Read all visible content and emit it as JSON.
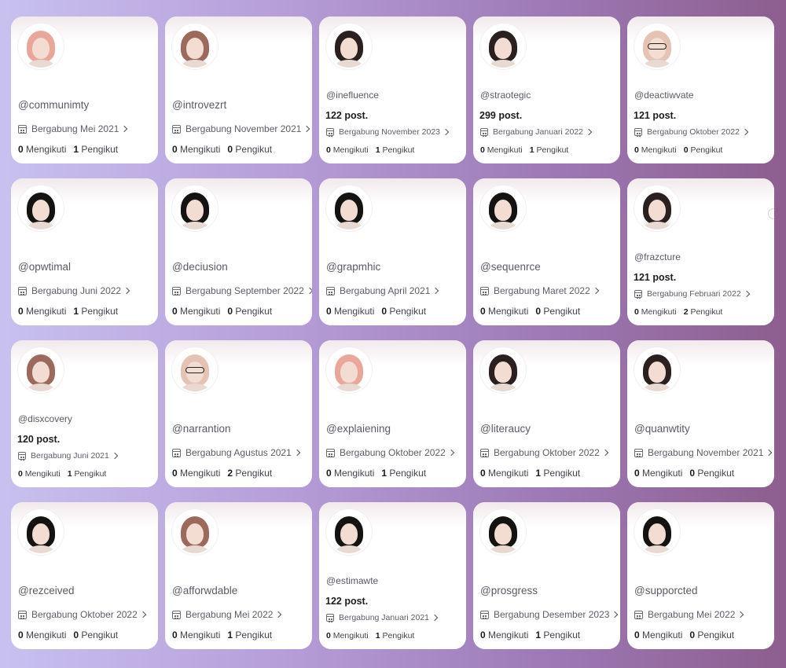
{
  "cards": [
    {
      "handle": "@communimty",
      "posts": "",
      "joined": "Bergabung Mei 2021",
      "following_count": "0",
      "following_label": "Mengikuti",
      "followers_count": "1",
      "followers_label": "Pengikut",
      "avatar": "pink-hair"
    },
    {
      "handle": "@introvezrt",
      "posts": "",
      "joined": "Bergabung November 2021",
      "following_count": "0",
      "following_label": "Mengikuti",
      "followers_count": "0",
      "followers_label": "Pengikut",
      "avatar": "brown-hair"
    },
    {
      "handle": "@inefluence",
      "posts": "122 post.",
      "joined": "Bergabung November 2023",
      "following_count": "0",
      "following_label": "Mengikuti",
      "followers_count": "1",
      "followers_label": "Pengikut",
      "avatar": "dark-hair"
    },
    {
      "handle": "@straotegic",
      "posts": "299 post.",
      "joined": "Bergabung Januari 2022",
      "following_count": "0",
      "following_label": "Mengikuti",
      "followers_count": "1",
      "followers_label": "Pengikut",
      "avatar": "dark-hair"
    },
    {
      "handle": "@deactiwvate",
      "posts": "121 post.",
      "joined": "Bergabung Oktober 2022",
      "following_count": "0",
      "following_label": "Mengikuti",
      "followers_count": "0",
      "followers_label": "Pengikut",
      "avatar": "blonde-glasses"
    },
    {
      "handle": "@opwtimal",
      "posts": "",
      "joined": "Bergabung Juni 2022",
      "following_count": "0",
      "following_label": "Mengikuti",
      "followers_count": "1",
      "followers_label": "Pengikut",
      "avatar": "black-hair"
    },
    {
      "handle": "@deciusion",
      "posts": "",
      "joined": "Bergabung September 2022",
      "following_count": "0",
      "following_label": "Mengikuti",
      "followers_count": "0",
      "followers_label": "Pengikut",
      "avatar": "black-hair"
    },
    {
      "handle": "@grapmhic",
      "posts": "",
      "joined": "Bergabung April 2021",
      "following_count": "0",
      "following_label": "Mengikuti",
      "followers_count": "0",
      "followers_label": "Pengikut",
      "avatar": "black-hair"
    },
    {
      "handle": "@sequenrce",
      "posts": "",
      "joined": "Bergabung Maret 2022",
      "following_count": "0",
      "following_label": "Mengikuti",
      "followers_count": "0",
      "followers_label": "Pengikut",
      "avatar": "black-hair"
    },
    {
      "handle": "@frazcture",
      "posts": "121 post.",
      "joined": "Bergabung Februari 2022",
      "following_count": "0",
      "following_label": "Mengikuti",
      "followers_count": "2",
      "followers_label": "Pengikut",
      "avatar": "dark-hair"
    },
    {
      "handle": "@disxcovery",
      "posts": "120 post.",
      "joined": "Bergabung Juni 2021",
      "following_count": "0",
      "following_label": "Mengikuti",
      "followers_count": "1",
      "followers_label": "Pengikut",
      "avatar": "brown-hair"
    },
    {
      "handle": "@narrantion",
      "posts": "",
      "joined": "Bergabung Agustus 2021",
      "following_count": "0",
      "following_label": "Mengikuti",
      "followers_count": "2",
      "followers_label": "Pengikut",
      "avatar": "blonde-glasses"
    },
    {
      "handle": "@explaiening",
      "posts": "",
      "joined": "Bergabung Oktober 2022",
      "following_count": "0",
      "following_label": "Mengikuti",
      "followers_count": "1",
      "followers_label": "Pengikut",
      "avatar": "pink-hair"
    },
    {
      "handle": "@literaucy",
      "posts": "",
      "joined": "Bergabung Oktober 2022",
      "following_count": "0",
      "following_label": "Mengikuti",
      "followers_count": "1",
      "followers_label": "Pengikut",
      "avatar": "dark-hair"
    },
    {
      "handle": "@quanwtity",
      "posts": "",
      "joined": "Bergabung November 2021",
      "following_count": "0",
      "following_label": "Mengikuti",
      "followers_count": "0",
      "followers_label": "Pengikut",
      "avatar": "dark-hair"
    },
    {
      "handle": "@rezceived",
      "posts": "",
      "joined": "Bergabung Oktober 2022",
      "following_count": "0",
      "following_label": "Mengikuti",
      "followers_count": "0",
      "followers_label": "Pengikut",
      "avatar": "black-hair"
    },
    {
      "handle": "@afforwdable",
      "posts": "",
      "joined": "Bergabung Mei 2022",
      "following_count": "0",
      "following_label": "Mengikuti",
      "followers_count": "1",
      "followers_label": "Pengikut",
      "avatar": "brown-hair"
    },
    {
      "handle": "@estimawte",
      "posts": "122 post.",
      "joined": "Bergabung Januari 2021",
      "following_count": "0",
      "following_label": "Mengikuti",
      "followers_count": "1",
      "followers_label": "Pengikut",
      "avatar": "black-hair"
    },
    {
      "handle": "@prosgress",
      "posts": "",
      "joined": "Bergabung Desember 2023",
      "following_count": "0",
      "following_label": "Mengikuti",
      "followers_count": "1",
      "followers_label": "Pengikut",
      "avatar": "black-hair"
    },
    {
      "handle": "@supporcted",
      "posts": "",
      "joined": "Bergabung Mei 2022",
      "following_count": "0",
      "following_label": "Mengikuti",
      "followers_count": "0",
      "followers_label": "Pengikut",
      "avatar": "black-hair"
    }
  ],
  "colors": {
    "background_start": "#c8c1ef",
    "background_end": "#8d5e8e",
    "card": "#ffffff",
    "text_primary": "#1a1a1f",
    "text_secondary": "#5a5a66"
  }
}
